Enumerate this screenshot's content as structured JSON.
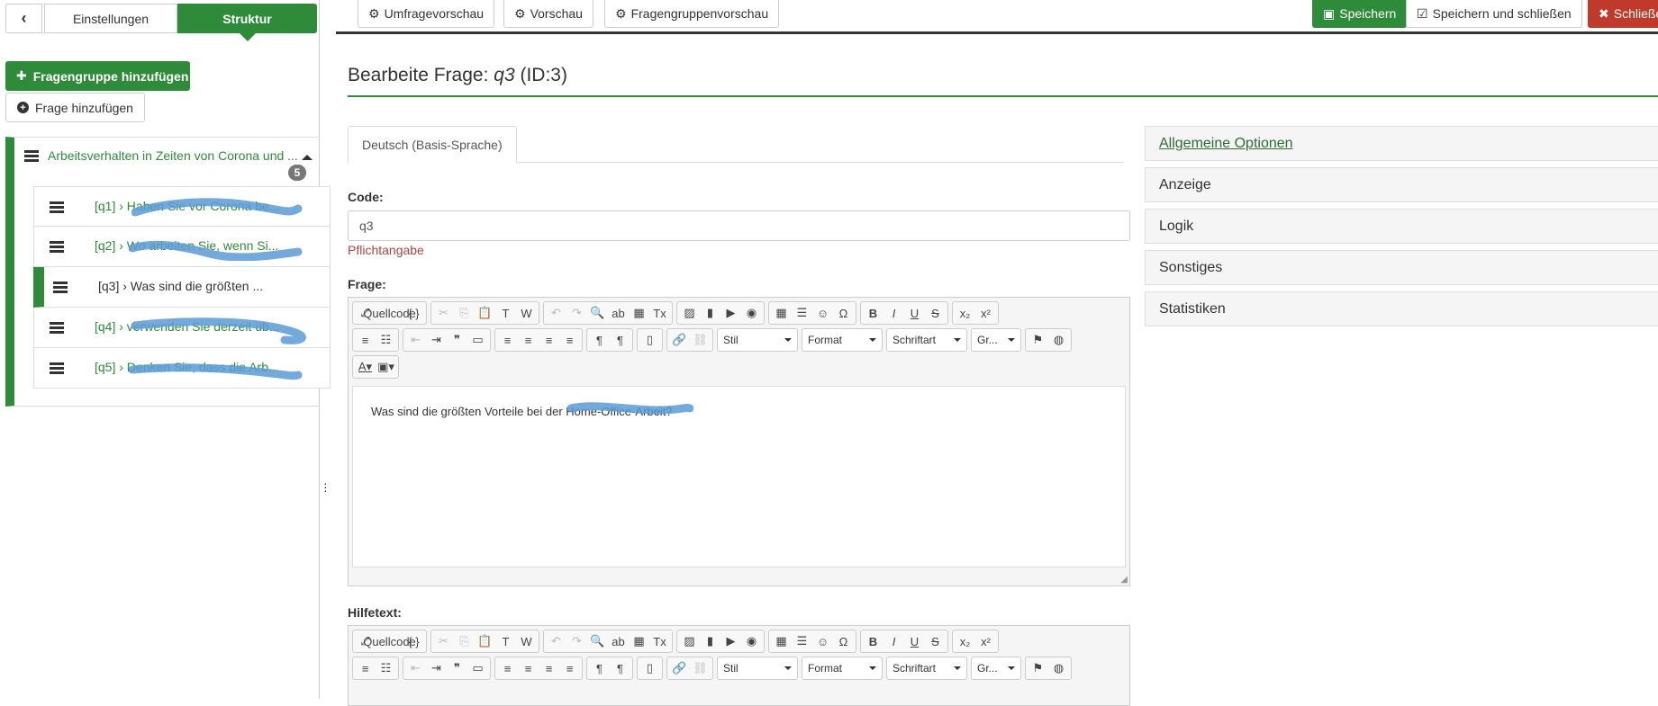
{
  "sidebar": {
    "back_icon": "chevron-left-icon",
    "tab_settings": "Einstellungen",
    "tab_structure": "Struktur",
    "add_group": "Fragengruppe hinzufügen",
    "add_question": "Frage hinzufügen",
    "group": {
      "title": "Arbeitsverhalten in Zeiten von Corona und ...",
      "count": "5"
    },
    "questions": [
      {
        "label": "[q1] › Haben Sie vor Corona be..."
      },
      {
        "label": "[q2] › Wo arbeiten Sie, wenn Si..."
      },
      {
        "label": "[q3] › Was sind die größten ..."
      },
      {
        "label": "[q4] › verwenden Sie derzeit üb..."
      },
      {
        "label": "[q5] › Denken Sie, dass die Arb..."
      }
    ]
  },
  "topbar": {
    "survey_preview": "Umfragevorschau",
    "preview": "Vorschau",
    "group_preview": "Fragengruppenvorschau",
    "save": "Speichern",
    "save_close": "Speichern und schließen",
    "close": "Schließe"
  },
  "page": {
    "title_prefix": "Bearbeite Frage: ",
    "question_code": "q3",
    "title_suffix": " (ID:3)",
    "language_tab": "Deutsch (Basis-Sprache)",
    "code_label": "Code:",
    "code_value": "q3",
    "required": "Pflichtangabe",
    "question_label": "Frage:",
    "question_text": "Was sind die größten Vorteile bei der Home-Office-Arbeit?",
    "help_label": "Hilfetext:"
  },
  "editor_toolbar": {
    "source": "Quellcode",
    "style": "Stil",
    "format": "Format",
    "font": "Schriftart",
    "size": "Gr..."
  },
  "accordion": [
    {
      "label": "Allgemeine Optionen"
    },
    {
      "label": "Anzeige"
    },
    {
      "label": "Logik"
    },
    {
      "label": "Sonstiges"
    },
    {
      "label": "Statistiken"
    }
  ],
  "colors": {
    "primary": "#2e8b3a",
    "danger": "#c0392b",
    "scribble": "#5b9bd5"
  }
}
